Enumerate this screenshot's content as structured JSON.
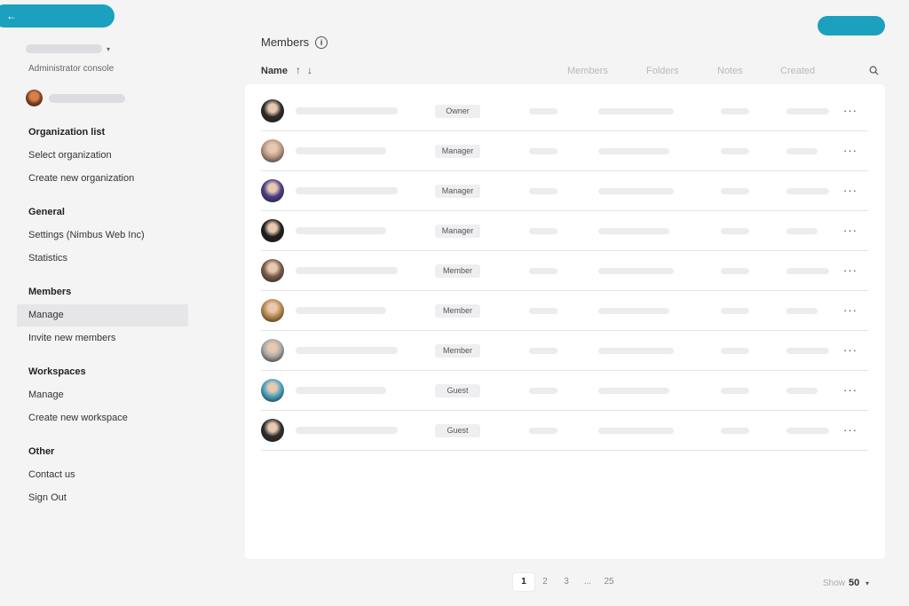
{
  "sidebar": {
    "back_icon": "←",
    "org_caret": "▾",
    "admin_label": "Administrator console",
    "sections": [
      {
        "title": "Organization list",
        "items": [
          "Select organization",
          "Create new organization"
        ]
      },
      {
        "title": "General",
        "items": [
          "Settings (Nimbus Web Inc)",
          "Statistics"
        ]
      },
      {
        "title": "Members",
        "items": [
          "Manage",
          "Invite new members"
        ]
      },
      {
        "title": "Workspaces",
        "items": [
          "Manage",
          "Create new workspace"
        ]
      },
      {
        "title": "Other",
        "items": [
          "Contact us",
          "Sign Out"
        ]
      }
    ],
    "active_item": "Members/Manage"
  },
  "content": {
    "title": "Members",
    "info_icon": "i",
    "columns": {
      "name": "Name",
      "members": "Members",
      "folders": "Folders",
      "notes": "Notes",
      "created": "Created"
    },
    "sort_up": "↑",
    "sort_down": "↓",
    "rows": [
      {
        "role": "Owner",
        "avatar_color": "#2c2c2c"
      },
      {
        "role": "Manager",
        "avatar_color": "#b89a84"
      },
      {
        "role": "Manager",
        "avatar_color": "#4a3f8a"
      },
      {
        "role": "Manager",
        "avatar_color": "#1e1e1e"
      },
      {
        "role": "Member",
        "avatar_color": "#7a5b4a"
      },
      {
        "role": "Member",
        "avatar_color": "#b88a4e"
      },
      {
        "role": "Member",
        "avatar_color": "#a8a8a8"
      },
      {
        "role": "Guest",
        "avatar_color": "#4aa3c0"
      },
      {
        "role": "Guest",
        "avatar_color": "#2e2e2e"
      }
    ],
    "more_icon": "···"
  },
  "pagination": {
    "pages": [
      "1",
      "2",
      "3",
      "...",
      "25"
    ],
    "current": "1",
    "show_label": "Show",
    "show_value": "50",
    "show_caret": "▾"
  },
  "colors": {
    "accent": "#1ba1bf"
  }
}
